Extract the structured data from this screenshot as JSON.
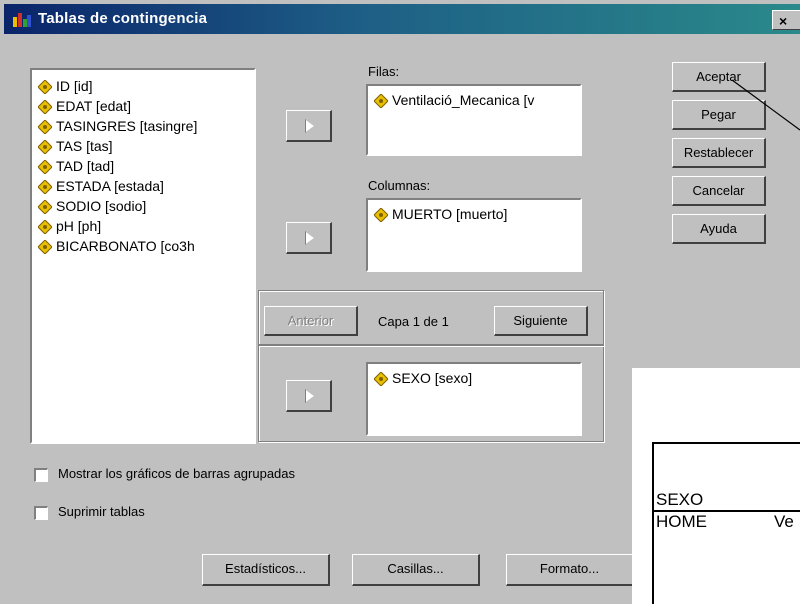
{
  "dialog": {
    "title": "Tablas de contingencia",
    "close_label": "×"
  },
  "variables": [
    {
      "label": "ID [id]"
    },
    {
      "label": "EDAT [edat]"
    },
    {
      "label": "TASINGRES [tasingre]"
    },
    {
      "label": "TAS [tas]"
    },
    {
      "label": "TAD [tad]"
    },
    {
      "label": "ESTADA [estada]"
    },
    {
      "label": "SODIO [sodio]"
    },
    {
      "label": "pH [ph]"
    },
    {
      "label": "BICARBONATO [co3h"
    }
  ],
  "filas": {
    "label": "Filas:",
    "items": [
      "Ventilació_Mecanica [v"
    ]
  },
  "columnas": {
    "label": "Columnas:",
    "items": [
      "MUERTO [muerto]"
    ]
  },
  "capa": {
    "anterior_label": "Anterior",
    "status": "Capa 1 de 1",
    "siguiente_label": "Siguiente",
    "items": [
      "SEXO [sexo]"
    ]
  },
  "actions": {
    "aceptar": "Aceptar",
    "pegar": "Pegar",
    "restablecer": "Restablecer",
    "cancelar": "Cancelar",
    "ayuda": "Ayuda"
  },
  "options": {
    "mostrar_graficos": "Mostrar los gráficos de barras agrupadas",
    "suprimir_tablas": "Suprimir tablas"
  },
  "bottom_buttons": {
    "estadisticos": "Estadísticos...",
    "casillas": "Casillas...",
    "formato": "Formato..."
  },
  "overlay": {
    "header_left": "SEXO",
    "row_left": "HOME",
    "row_right": "Ve"
  },
  "colors": {
    "dialog_bg": "#c0c0c0",
    "title_start": "#0a246a",
    "title_end": "#2a8a8a",
    "variable_icon": "#e8c000"
  },
  "icons": {
    "variable": "scale-variable-icon",
    "move": "arrow-right-icon",
    "title": "spss-app-icon"
  }
}
